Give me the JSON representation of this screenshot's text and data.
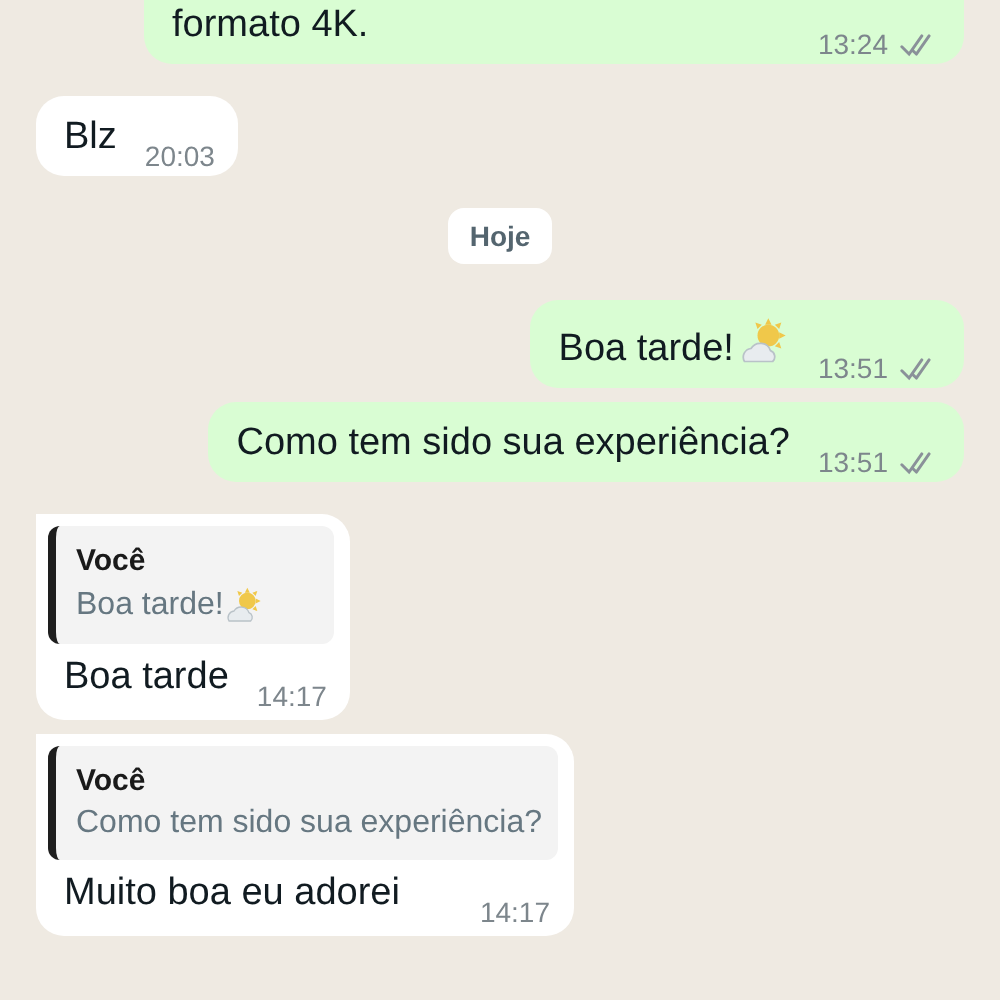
{
  "messages": [
    {
      "kind": "outgoing",
      "text": "formato 4K.",
      "time": "13:24",
      "read": false,
      "has_emoji": false
    },
    {
      "kind": "incoming",
      "text": "Blz",
      "time": "20:03",
      "has_emoji": false
    },
    {
      "kind": "date",
      "text": "Hoje"
    },
    {
      "kind": "outgoing",
      "text": "Boa tarde!",
      "time": "13:51",
      "read": false,
      "has_emoji": true
    },
    {
      "kind": "outgoing",
      "text": "Como tem sido sua experiência?",
      "time": "13:51",
      "read": false,
      "has_emoji": false
    },
    {
      "kind": "incoming",
      "text": "Boa tarde",
      "time": "14:17",
      "has_emoji": false,
      "reply": {
        "author": "Você",
        "text": "Boa tarde!",
        "has_emoji": true
      }
    },
    {
      "kind": "incoming",
      "text": "Muito boa eu adorei",
      "time": "14:17",
      "has_emoji": false,
      "reply": {
        "author": "Você",
        "text": "Como tem sido sua experiência?",
        "has_emoji": false
      }
    }
  ]
}
